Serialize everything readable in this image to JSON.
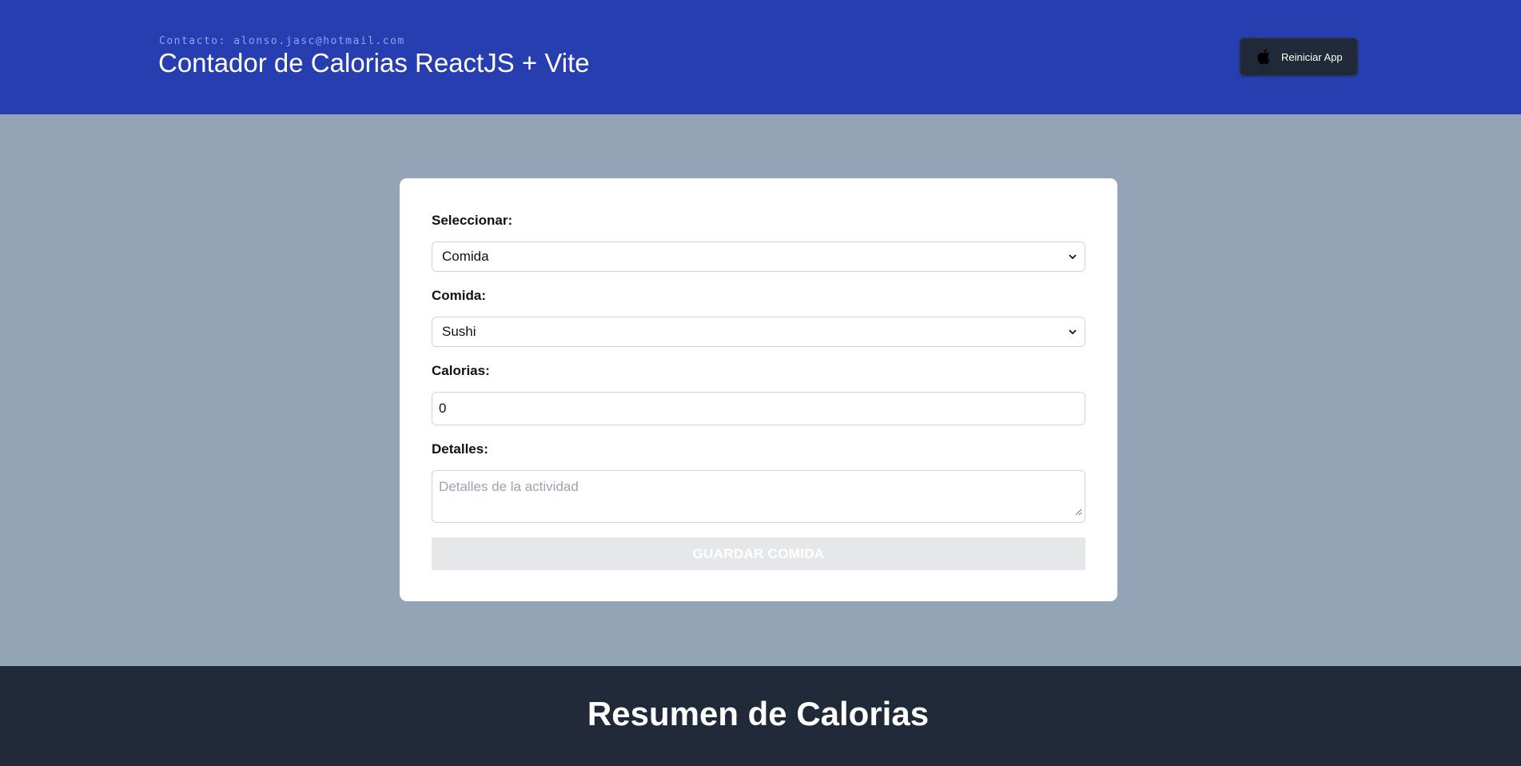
{
  "header": {
    "contact": "Contacto: alonso.jasc@hotmail.com",
    "title": "Contador de Calorias ReactJS + Vite",
    "reset_button": {
      "label": "Reiniciar App",
      "icon": "apple-icon"
    }
  },
  "form": {
    "category": {
      "label": "Seleccionar:",
      "value": "Comida"
    },
    "food": {
      "label": "Comida:",
      "value": "Sushi"
    },
    "calories": {
      "label": "Calorias:",
      "value": "0"
    },
    "details": {
      "label": "Detalles:",
      "placeholder": "Detalles de la actividad"
    },
    "submit_label": "GUARDAR COMIDA"
  },
  "summary": {
    "title": "Resumen de Calorias"
  },
  "colors": {
    "header_bg": "#263eaf",
    "page_bg": "#94a3b8",
    "footer_bg": "#1f2937",
    "button_disabled_bg": "#e5e7eb"
  }
}
